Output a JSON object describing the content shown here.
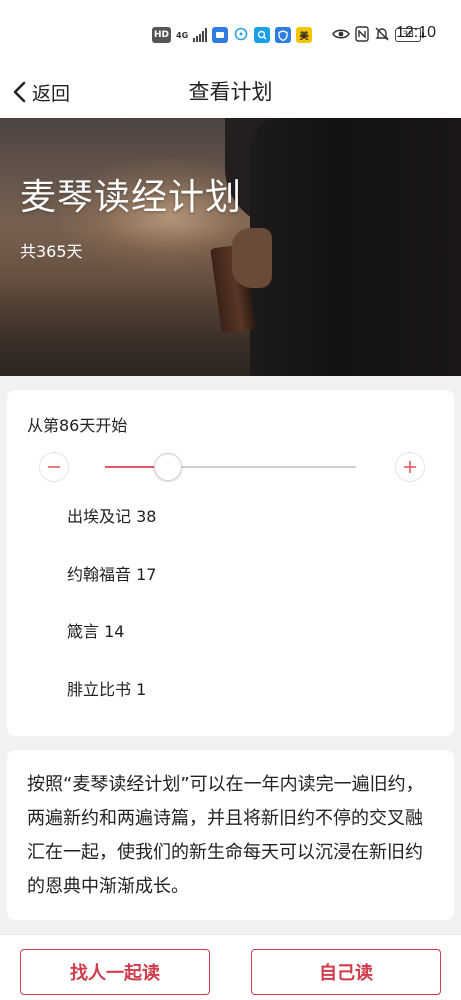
{
  "status_bar": {
    "icons": [
      "hd-icon",
      "4g-signal-icon",
      "cellular-signal-icon",
      "app-notification-icon",
      "chat-notification-icon",
      "search-app-icon",
      "shield-app-icon",
      "meituan-app-icon",
      "eye-icon",
      "nfc-icon",
      "mute-icon",
      "battery-icon"
    ],
    "hd_label": "HD",
    "network_label": "4G",
    "meituan_label": "美",
    "battery_level": "38",
    "time": "12:10"
  },
  "nav": {
    "back_label": "返回",
    "title": "查看计划"
  },
  "hero": {
    "title": "麦琴读经计划",
    "subtitle": "共365天"
  },
  "start": {
    "label": "从第86天开始",
    "slider_fraction": 0.25,
    "accent_color": "#e05a64",
    "readings": [
      {
        "text": "出埃及记 38"
      },
      {
        "text": "约翰福音 17"
      },
      {
        "text": "箴言 14"
      },
      {
        "text": "腓立比书 1"
      }
    ]
  },
  "description": {
    "text": "按照“麦琴读经计划”可以在一年内读完一遍旧约，两遍新约和两遍诗篇，并且将新旧约不停的交叉融汇在一起，使我们的新生命每天可以沉浸在新旧约的恩典中渐渐成长。"
  },
  "footer": {
    "read_together_label": "找人一起读",
    "read_self_label": "自己读",
    "button_color": "#d23b4c"
  }
}
